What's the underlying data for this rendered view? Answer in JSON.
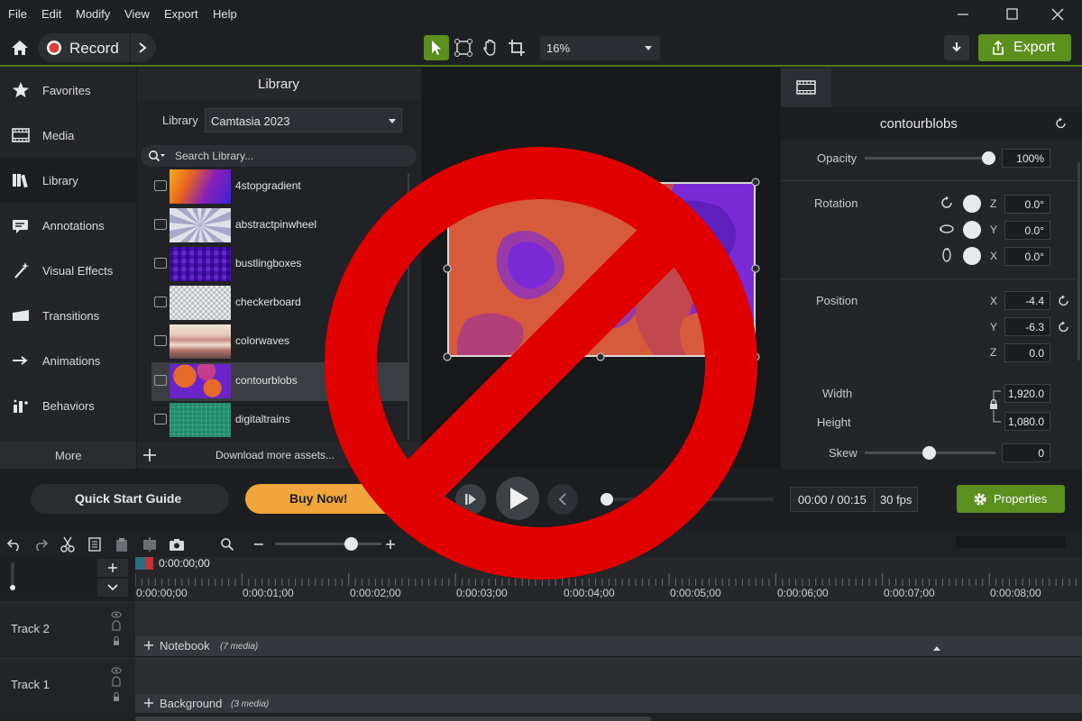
{
  "menubar": {
    "items": [
      "File",
      "Edit",
      "Modify",
      "View",
      "Export",
      "Help"
    ]
  },
  "toolbar": {
    "record_label": "Record",
    "zoom_value": "16%",
    "export_label": "Export"
  },
  "left_rail": {
    "items": [
      {
        "label": "Favorites",
        "icon": "star-icon"
      },
      {
        "label": "Media",
        "icon": "film-icon"
      },
      {
        "label": "Library",
        "icon": "books-icon"
      },
      {
        "label": "Annotations",
        "icon": "annotation-icon"
      },
      {
        "label": "Visual Effects",
        "icon": "wand-icon"
      },
      {
        "label": "Transitions",
        "icon": "transition-icon"
      },
      {
        "label": "Animations",
        "icon": "arrow-icon"
      },
      {
        "label": "Behaviors",
        "icon": "behaviors-icon"
      }
    ],
    "more_label": "More"
  },
  "library": {
    "title": "Library",
    "selector_label": "Library",
    "selector_value": "Camtasia 2023",
    "search_placeholder": "Search Library...",
    "items": [
      {
        "name": "4stopgradient"
      },
      {
        "name": "abstractpinwheel"
      },
      {
        "name": "bustlingboxes"
      },
      {
        "name": "checkerboard"
      },
      {
        "name": "colorwaves"
      },
      {
        "name": "contourblobs",
        "selected": true
      },
      {
        "name": "digitaltrains"
      }
    ],
    "download_label": "Download more assets..."
  },
  "properties": {
    "title": "contourblobs",
    "opacity_label": "Opacity",
    "opacity_value": "100%",
    "rotation_label": "Rotation",
    "rotation": {
      "z": "0.0°",
      "y": "0.0°",
      "x": "0.0°"
    },
    "position_label": "Position",
    "position": {
      "x": "-4.4",
      "y": "-6.3",
      "z": "0.0"
    },
    "width_label": "Width",
    "width_value": "1,920.0",
    "height_label": "Height",
    "height_value": "1,080.0",
    "skew_label": "Skew",
    "skew_value": "0",
    "axis_labels": {
      "x": "X",
      "y": "Y",
      "z": "Z"
    }
  },
  "bottombar": {
    "quick_start_label": "Quick Start Guide",
    "buy_now_label": "Buy Now!",
    "time_display": "00:00 / 00:15",
    "fps": "30 fps",
    "properties_label": "Properties"
  },
  "timeline": {
    "playhead_time": "0:00:00;00",
    "ticks": [
      "0:00:00;00",
      "0:00:01;00",
      "0:00:02;00",
      "0:00:03;00",
      "0:00:04;00",
      "0:00:05;00",
      "0:00:06;00",
      "0:00:07;00",
      "0:00:08;00"
    ],
    "tracks": [
      {
        "name": "Track 2",
        "group_label": "Notebook",
        "group_count": "(7 media)"
      },
      {
        "name": "Track 1",
        "group_label": "Background",
        "group_count": "(3 media)"
      }
    ]
  },
  "colors": {
    "accent_green": "#5b8f1e",
    "buy_orange": "#f0a63a",
    "record_red": "#e23b3b",
    "ban_red": "#e00000"
  }
}
